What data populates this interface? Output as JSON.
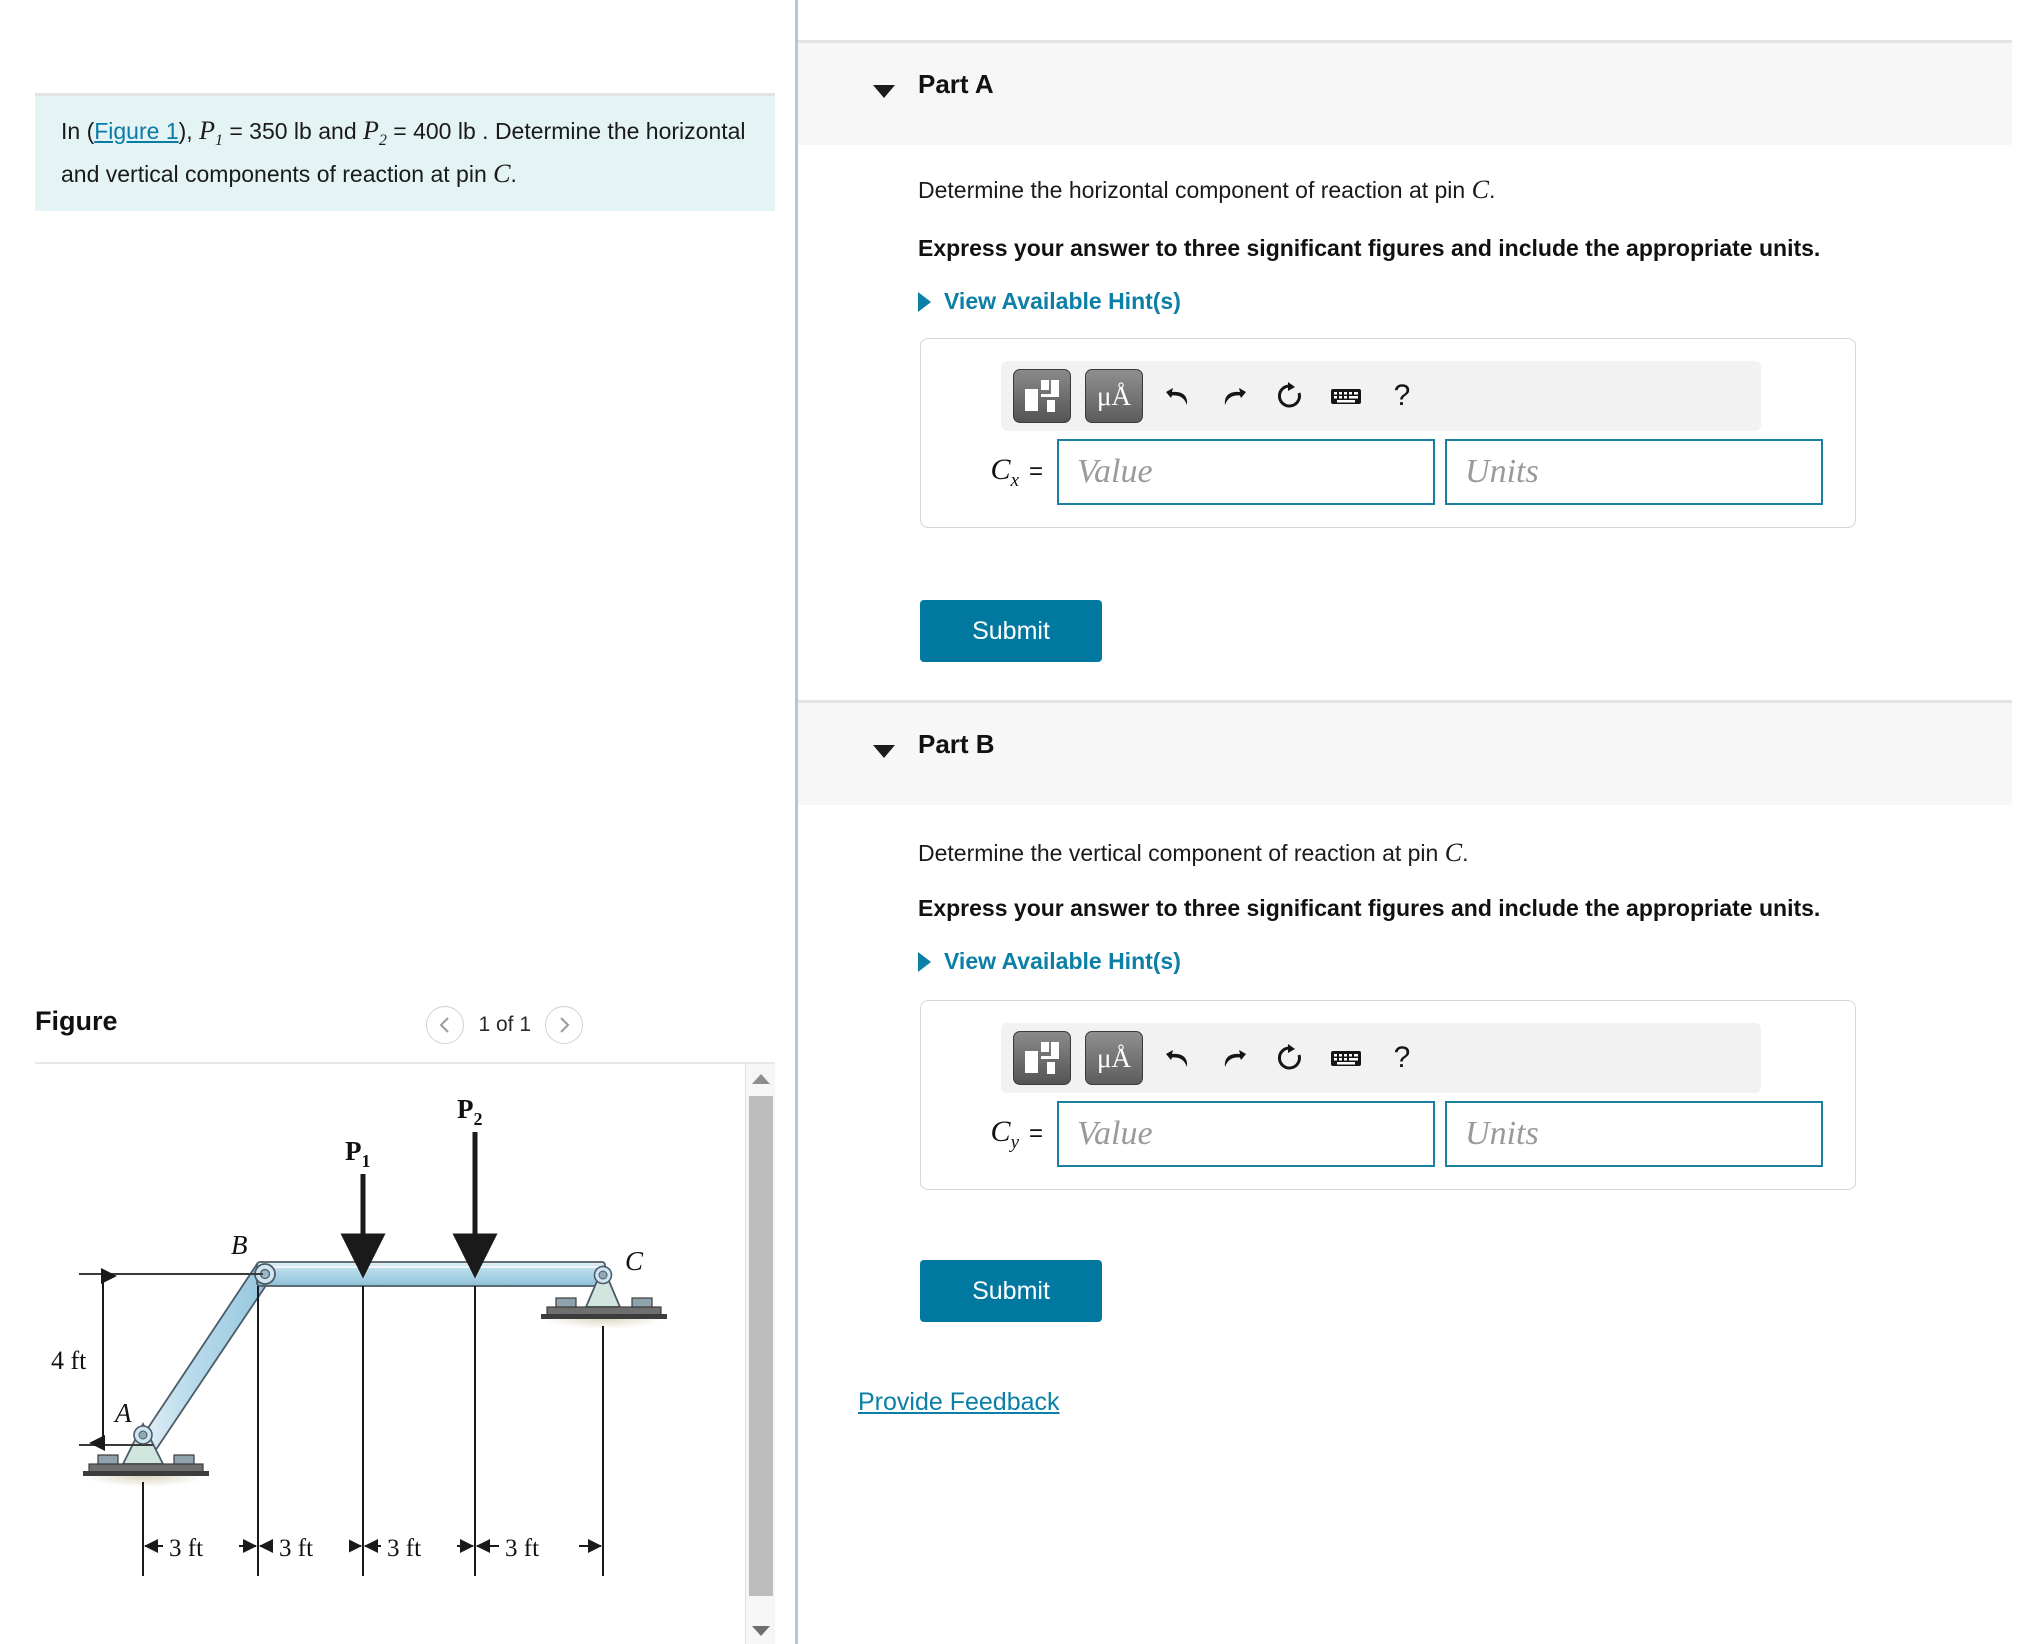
{
  "question": {
    "prefix": "In (",
    "figure_link": "Figure 1",
    "after_link": "), ",
    "p1_symbol": "P",
    "p1_sub": "1",
    "p1_value": " = 350 lb",
    "and_text": " and ",
    "p2_symbol": "P",
    "p2_sub": "2",
    "p2_value": " = 400 lb",
    "sentence_tail": " . Determine the horizontal and vertical components of reaction at pin ",
    "pin_symbol": "C",
    "period": "."
  },
  "figure": {
    "title": "Figure",
    "counter": "1 of 1",
    "prev_icon": "chevron-left-icon",
    "next_icon": "chevron-right-icon",
    "scrollbar": {
      "up_icon": "triangle-up-icon",
      "down_icon": "triangle-down-icon"
    },
    "diagram": {
      "labels": {
        "A": "A",
        "B": "B",
        "C": "C",
        "P1": "P",
        "P1_sub": "1",
        "P2": "P",
        "P2_sub": "2",
        "height": "4 ft",
        "seg1": "3 ft",
        "seg2": "3 ft",
        "seg3": "3 ft",
        "seg4": "3 ft"
      },
      "colors": {
        "member_fill": "#aed6e8",
        "member_edge": "#4c5b66",
        "support_fill": "#cce5dd",
        "ground": "#4a4a4a"
      }
    }
  },
  "parts": [
    {
      "id": "part-a",
      "title": "Part A",
      "caret_icon": "caret-down-icon",
      "prompt_prefix": "Determine the horizontal component of reaction at pin ",
      "prompt_symbol": "C",
      "prompt_suffix": ".",
      "instruction": "Express your answer to three significant figures and include the appropriate units.",
      "hints_label": "View Available Hint(s)",
      "hints_caret_icon": "caret-right-icon",
      "answer": {
        "label_symbol": "C",
        "label_sub": "x",
        "equals": "=",
        "value_placeholder": "Value",
        "units_placeholder": "Units",
        "value_text": "",
        "units_text": ""
      },
      "toolbar": {
        "template_icon": "math-template-icon",
        "units_icon": "micro-angstrom-units-icon",
        "units_text": "μÅ",
        "undo_icon": "undo-arrow-icon",
        "redo_icon": "redo-arrow-icon",
        "reset_icon": "reset-circular-arrow-icon",
        "keyboard_icon": "keyboard-icon",
        "help_icon": "question-mark-icon",
        "help_text": "?"
      },
      "submit_label": "Submit"
    },
    {
      "id": "part-b",
      "title": "Part B",
      "caret_icon": "caret-down-icon",
      "prompt_prefix": "Determine the vertical component of reaction at pin ",
      "prompt_symbol": "C",
      "prompt_suffix": ".",
      "instruction": "Express your answer to three significant figures and include the appropriate units.",
      "hints_label": "View Available Hint(s)",
      "hints_caret_icon": "caret-right-icon",
      "answer": {
        "label_symbol": "C",
        "label_sub": "y",
        "equals": "=",
        "value_placeholder": "Value",
        "units_placeholder": "Units",
        "value_text": "",
        "units_text": ""
      },
      "toolbar": {
        "template_icon": "math-template-icon",
        "units_icon": "micro-angstrom-units-icon",
        "units_text": "μÅ",
        "undo_icon": "undo-arrow-icon",
        "redo_icon": "redo-arrow-icon",
        "reset_icon": "reset-circular-arrow-icon",
        "keyboard_icon": "keyboard-icon",
        "help_icon": "question-mark-icon",
        "help_text": "?"
      },
      "submit_label": "Submit"
    }
  ],
  "footer": {
    "feedback_label": "Provide Feedback"
  },
  "colors": {
    "accent_teal": "#0b7fa6",
    "submit_bg": "#0078a0",
    "question_bg": "#e4f3f3",
    "part_header_bg": "#f7f7f7",
    "divider": "#b6c6d4"
  }
}
